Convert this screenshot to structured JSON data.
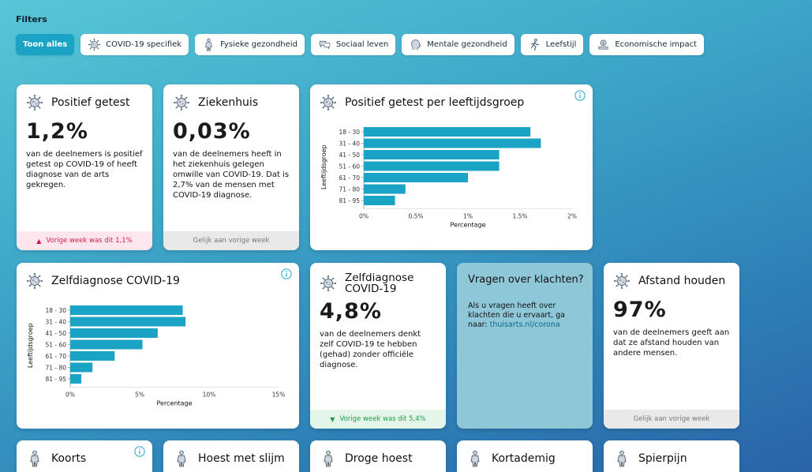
{
  "filters": {
    "title": "Filters",
    "items": [
      "Toon alles",
      "COVID-19 specifiek",
      "Fysieke gezondheid",
      "Sociaal leven",
      "Mentale gezondheid",
      "Leefstijl",
      "Economische impact"
    ]
  },
  "cards": {
    "positief": {
      "title": "Positief getest",
      "value": "1,2%",
      "desc": "van de deelnemers is positief getest op COVID-19 of heeft diagnose van de arts gekregen.",
      "footer": "Vorige week was dit 1,1%"
    },
    "ziekenhuis": {
      "title": "Ziekenhuis",
      "value": "0,03%",
      "desc": "van de deelnemers heeft in het ziekenhuis gelegen omwille van COVID-19. Dat is 2,7% van de mensen met COVID-19 diagnose.",
      "footer": "Gelijk aan vorige week"
    },
    "zelfdiag": {
      "title_line1": "Zelfdiagnose",
      "title_line2": "COVID-19",
      "value": "4,8%",
      "desc": "van de deelnemers denkt zelf COVID-19 te hebben (gehad) zonder officiële diagnose.",
      "footer": "Vorige week was dit 5,4%"
    },
    "vragen": {
      "title": "Vragen over klachten?",
      "desc": "Als u vragen heeft over klachten die u ervaart, ga naar:",
      "link": "thuisarts.nl/corona"
    },
    "afstand": {
      "title": "Afstand houden",
      "value": "97%",
      "desc": "van de deelnemers geeft aan dat ze afstand houden van andere mensen.",
      "footer": "Gelijk aan vorige week"
    },
    "symptoms": [
      "Koorts",
      "Hoest met slijm",
      "Droge hoest",
      "Kortademig",
      "Spierpijn"
    ]
  },
  "chart_data": [
    {
      "type": "bar",
      "orientation": "horizontal",
      "title": "Positief getest per leeftijdsgroep",
      "categories": [
        "18 - 30",
        "31 - 40",
        "41 - 50",
        "51 - 60",
        "61 - 70",
        "71 - 80",
        "81 - 95"
      ],
      "values": [
        1.6,
        1.7,
        1.3,
        1.3,
        1.0,
        0.4,
        0.3
      ],
      "xlabel": "Percentage",
      "ylabel": "Leeftijdsgroep",
      "xticks": [
        "0%",
        "0.5%",
        "1%",
        "1.5%",
        "2%"
      ],
      "xlim": [
        0,
        2
      ],
      "color": "#1aa3c4"
    },
    {
      "type": "bar",
      "orientation": "horizontal",
      "title": "Zelfdiagnose COVID-19",
      "categories": [
        "18 - 30",
        "31 - 40",
        "41 - 50",
        "51 - 60",
        "61 - 70",
        "71 - 80",
        "81 - 95"
      ],
      "values": [
        8.1,
        8.3,
        6.3,
        5.2,
        3.2,
        1.6,
        0.8
      ],
      "xlabel": "Percentage",
      "ylabel": "Leeftijdsgroep",
      "xticks": [
        "0%",
        "5%",
        "10%",
        "15%"
      ],
      "xlim": [
        0,
        15
      ],
      "color": "#1aa3c4"
    }
  ]
}
